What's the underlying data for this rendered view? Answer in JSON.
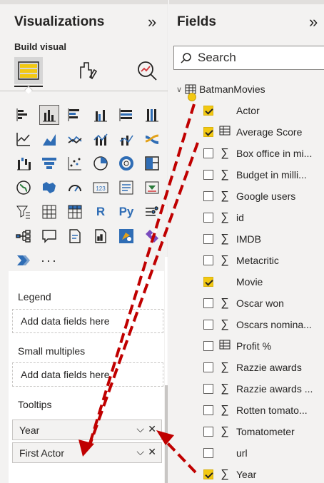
{
  "visualizations": {
    "title": "Visualizations",
    "collapse_icon": "double-chevron-right-icon",
    "build_label": "Build visual",
    "modes": [
      "build-visual-icon",
      "format-visual-icon",
      "analytics-icon"
    ],
    "more_label": "···"
  },
  "wells": {
    "legend": {
      "label": "Legend",
      "placeholder": "Add data fields here"
    },
    "small_multiples": {
      "label": "Small multiples",
      "placeholder": "Add data fields here"
    },
    "tooltips": {
      "label": "Tooltips",
      "items": [
        "Year",
        "First Actor"
      ]
    }
  },
  "fields": {
    "title": "Fields",
    "collapse_icon": "double-chevron-right-icon",
    "search_placeholder": "Search",
    "table_name": "BatmanMovies",
    "items": [
      {
        "name": "Actor",
        "checked": true,
        "type": "text"
      },
      {
        "name": "Average Score",
        "checked": true,
        "type": "table"
      },
      {
        "name": "Box office in mi...",
        "checked": false,
        "type": "sigma"
      },
      {
        "name": "Budget in milli...",
        "checked": false,
        "type": "sigma"
      },
      {
        "name": "Google users",
        "checked": false,
        "type": "sigma"
      },
      {
        "name": "id",
        "checked": false,
        "type": "sigma"
      },
      {
        "name": "IMDB",
        "checked": false,
        "type": "sigma"
      },
      {
        "name": "Metacritic",
        "checked": false,
        "type": "sigma"
      },
      {
        "name": "Movie",
        "checked": true,
        "type": "text"
      },
      {
        "name": "Oscar won",
        "checked": false,
        "type": "sigma"
      },
      {
        "name": "Oscars nomina...",
        "checked": false,
        "type": "sigma"
      },
      {
        "name": "Profit %",
        "checked": false,
        "type": "table"
      },
      {
        "name": "Razzie awards",
        "checked": false,
        "type": "sigma"
      },
      {
        "name": "Razzie awards ...",
        "checked": false,
        "type": "sigma"
      },
      {
        "name": "Rotten tomato...",
        "checked": false,
        "type": "sigma"
      },
      {
        "name": "Tomatometer",
        "checked": false,
        "type": "sigma"
      },
      {
        "name": "url",
        "checked": false,
        "type": "text"
      },
      {
        "name": "Year",
        "checked": true,
        "type": "sigma"
      }
    ]
  },
  "annotation": {
    "arrow_color": "#c00000"
  }
}
